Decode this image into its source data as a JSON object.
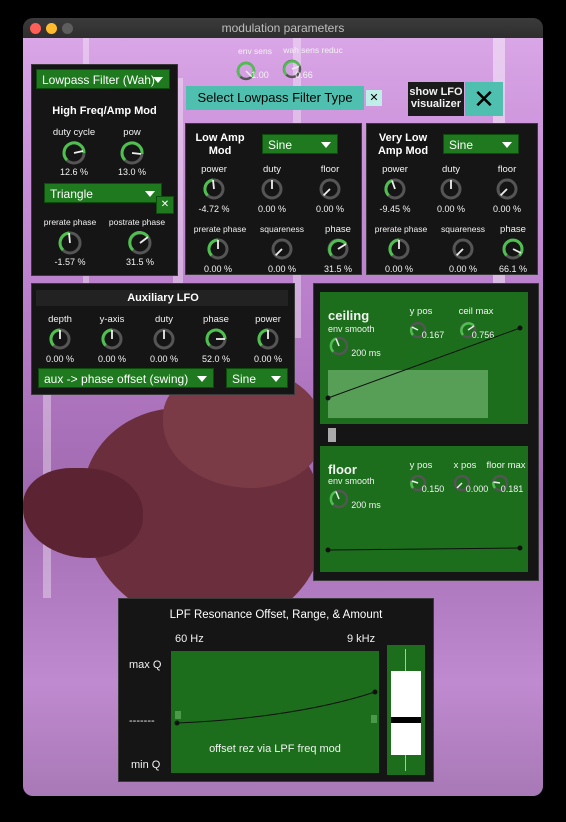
{
  "window": {
    "title": "modulation parameters"
  },
  "top": {
    "env_sens": {
      "label": "env sens",
      "value": "1.00"
    },
    "wah_sens_reduc": {
      "label": "wah sens reduc",
      "value": "0.66"
    },
    "select_lpf_button": "Select Lowpass Filter Type",
    "select_lpf_close": "✕",
    "show_lfo_label": "show LFO visualizer",
    "show_lfo_close": "✕"
  },
  "filter_panel": {
    "filter_dropdown": "Lowpass Filter (Wah)",
    "title": "High Freq/Amp Mod",
    "knobs": [
      {
        "label": "duty cycle",
        "value": "12.6 %"
      },
      {
        "label": "pow",
        "value": "13.0 %"
      }
    ],
    "wave_dropdown": "Triangle",
    "wave_close": "✕",
    "knobs2": [
      {
        "label": "prerate phase",
        "value": "-1.57 %"
      },
      {
        "label": "postrate phase",
        "value": "31.5 %"
      }
    ]
  },
  "low_amp": {
    "title": "Low Amp Mod",
    "wave": "Sine",
    "knobs": [
      {
        "label": "power",
        "value": "-4.72 %"
      },
      {
        "label": "duty",
        "value": "0.00 %"
      },
      {
        "label": "floor",
        "value": "0.00 %"
      }
    ],
    "knobs2": [
      {
        "label": "prerate phase",
        "value": "0.00 %"
      },
      {
        "label": "squareness",
        "value": "0.00 %"
      },
      {
        "label": "phase",
        "value": "31.5 %"
      }
    ]
  },
  "very_low_amp": {
    "title": "Very Low Amp Mod",
    "wave": "Sine",
    "knobs": [
      {
        "label": "power",
        "value": "-9.45 %"
      },
      {
        "label": "duty",
        "value": "0.00 %"
      },
      {
        "label": "floor",
        "value": "0.00 %"
      }
    ],
    "knobs2": [
      {
        "label": "prerate phase",
        "value": "0.00 %"
      },
      {
        "label": "squareness",
        "value": "0.00 %"
      },
      {
        "label": "phase",
        "value": "66.1 %"
      }
    ]
  },
  "aux": {
    "title": "Auxiliary LFO",
    "knobs": [
      {
        "label": "depth",
        "value": "0.00 %"
      },
      {
        "label": "y-axis",
        "value": "0.00 %"
      },
      {
        "label": "duty",
        "value": "0.00 %"
      },
      {
        "label": "phase",
        "value": "52.0 %"
      },
      {
        "label": "power",
        "value": "0.00 %"
      }
    ],
    "target_dropdown": "aux -> phase offset (swing)",
    "wave_dropdown": "Sine"
  },
  "ceiling": {
    "title": "ceiling",
    "env_label": "env smooth",
    "env_value": "200 ms",
    "ypos_label": "y pos",
    "ypos_value": "0.167",
    "ceilmax_label": "ceil max",
    "ceilmax_value": "0.756"
  },
  "floor": {
    "title": "floor",
    "env_label": "env smooth",
    "env_value": "200 ms",
    "ypos_label": "y pos",
    "ypos_value": "0.150",
    "xpos_label": "x pos",
    "xpos_value": "0.000",
    "floormax_label": "floor max",
    "floormax_value": "0.181"
  },
  "lpf": {
    "title": "LPF Resonance Offset, Range, & Amount",
    "freq_low": "60 Hz",
    "freq_high": "9 kHz",
    "max_q": "max Q",
    "mid": "-------",
    "min_q": "min Q",
    "caption": "offset rez via LPF freq mod"
  }
}
